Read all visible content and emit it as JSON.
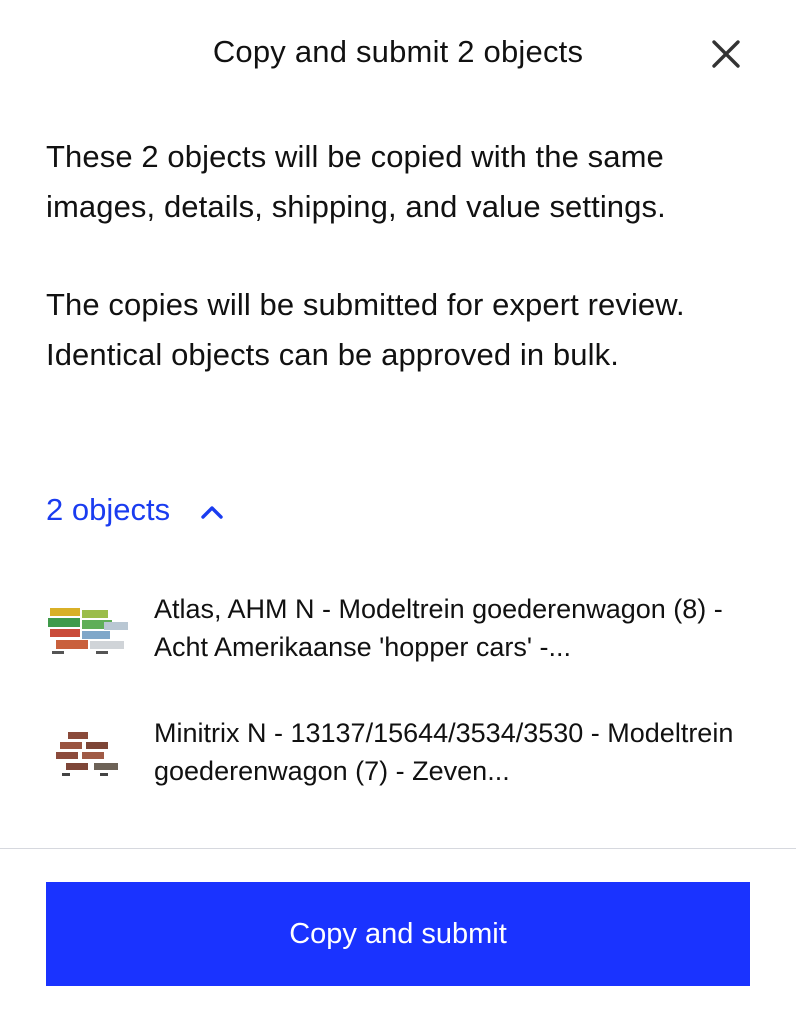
{
  "header": {
    "title": "Copy and submit 2 objects",
    "close_icon": "close-icon"
  },
  "body": {
    "paragraph_1": "These 2 objects will be copied with the same images, details, shipping, and value settings.",
    "paragraph_2": "The copies will be submitted for expert review. Identical objects can be approved in bulk."
  },
  "objects_toggle": {
    "label": "2 objects",
    "icon": "chevron-up-icon",
    "expanded": true
  },
  "objects": [
    {
      "title": "Atlas, AHM N - Modeltrein goederenwagon (8) - Acht Amerikaanse 'hopper cars' -...",
      "thumbnail": "model-train-wagons-thumbnail"
    },
    {
      "title": "Minitrix N - 13137/15644/3534/3530 - Modeltrein goederenwagon (7) - Zeven...",
      "thumbnail": "model-train-wagons-thumbnail"
    }
  ],
  "footer": {
    "primary_label": "Copy and submit"
  },
  "colors": {
    "accent": "#1a33ff",
    "link": "#1a3cf0",
    "text": "#111111",
    "divider": "#d6d8de"
  }
}
